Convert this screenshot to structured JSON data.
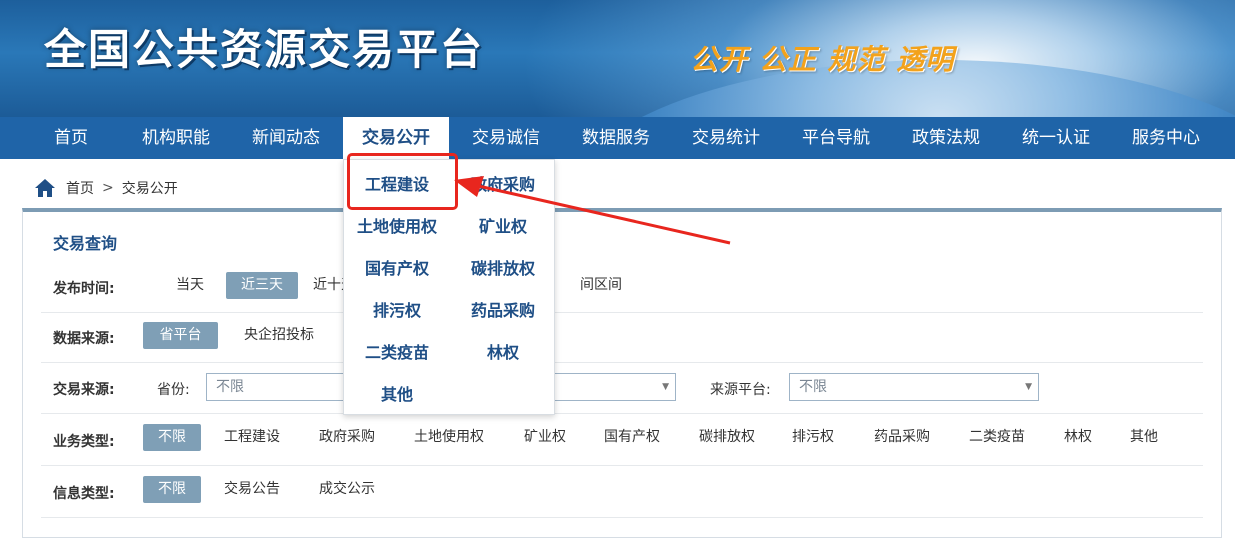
{
  "header": {
    "title": "全国公共资源交易平台",
    "slogan": "公开 公正 规范 透明"
  },
  "nav": {
    "items": [
      "首页",
      "机构职能",
      "新闻动态",
      "交易公开",
      "交易诚信",
      "数据服务",
      "交易统计",
      "平台导航",
      "政策法规",
      "统一认证",
      "服务中心"
    ],
    "active_index": 3
  },
  "breadcrumb": {
    "home_icon": "home-icon",
    "home": "首页",
    "separator": ">",
    "current": "交易公开"
  },
  "panel": {
    "title": "交易查询",
    "publish_time": {
      "label": "发布时间:",
      "options": [
        "当天",
        "近三天",
        "近十天",
        "间区间"
      ],
      "selected": "近三天"
    },
    "data_source": {
      "label": "数据来源:",
      "options": [
        "省平台",
        "央企招投标"
      ],
      "selected": "省平台"
    },
    "trade_source": {
      "label": "交易来源:",
      "province_label": "省份:",
      "province_value": "不限",
      "platform_label": "来源平台:",
      "platform_value": "不限"
    },
    "business_type": {
      "label": "业务类型:",
      "options": [
        "不限",
        "工程建设",
        "政府采购",
        "土地使用权",
        "矿业权",
        "国有产权",
        "碳排放权",
        "排污权",
        "药品采购",
        "二类疫苗",
        "林权",
        "其他"
      ],
      "selected": "不限"
    },
    "info_type": {
      "label": "信息类型:",
      "options": [
        "不限",
        "交易公告",
        "成交公示"
      ],
      "selected": "不限"
    }
  },
  "dropdown": {
    "items": [
      "工程建设",
      "政府采购",
      "土地使用权",
      "矿业权",
      "国有产权",
      "碳排放权",
      "排污权",
      "药品采购",
      "二类疫苗",
      "林权",
      "其他"
    ],
    "highlighted": "工程建设"
  },
  "colors": {
    "nav_bg": "#1f64a8",
    "accent": "#1f4f86",
    "selected_option": "#7f9fb6",
    "annotation_red": "#e8261e",
    "slogan": "#f3a21b"
  }
}
